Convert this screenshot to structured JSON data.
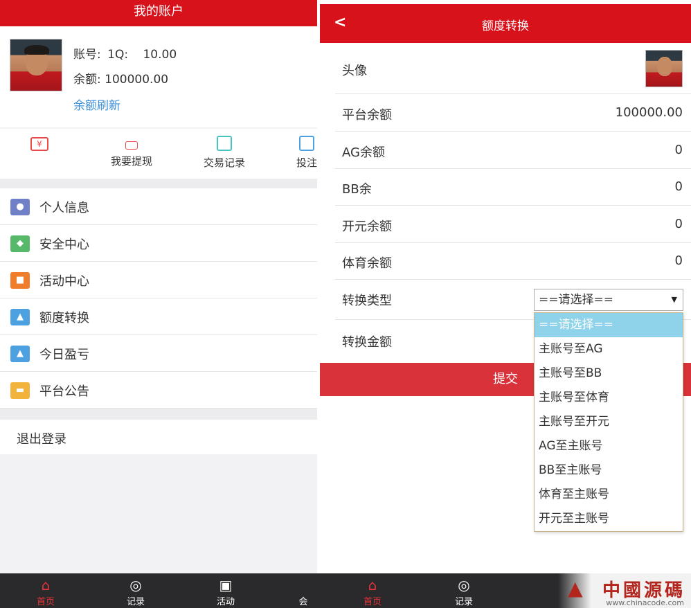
{
  "left_screen": {
    "title": "我的账户",
    "account_label": "账号:",
    "account_value": "1Q:",
    "account_extra": "10.00",
    "balance_label": "余额:",
    "balance_value": "100000.00",
    "refresh_link": "余额刷新",
    "quick_actions": [
      {
        "label": "我要提现",
        "icon": "withdraw-icon"
      },
      {
        "label": "交易记录",
        "icon": "transaction-icon"
      },
      {
        "label": "投注",
        "icon": "bet-icon"
      }
    ],
    "menu": [
      {
        "label": "个人信息",
        "icon": "user-icon",
        "color": "#6f7fc8"
      },
      {
        "label": "安全中心",
        "icon": "shield-icon",
        "color": "#56b96a"
      },
      {
        "label": "活动中心",
        "icon": "activity-icon",
        "color": "#ef7d2c"
      },
      {
        "label": "额度转换",
        "icon": "transfer-icon",
        "color": "#4da1e0"
      },
      {
        "label": "今日盈亏",
        "icon": "chart-icon",
        "color": "#4da1e0"
      },
      {
        "label": "平台公告",
        "icon": "notice-icon",
        "color": "#f2b33d"
      }
    ],
    "logout": "退出登录"
  },
  "right_screen": {
    "title": "额度转换",
    "rows": {
      "avatar": "头像",
      "platform_balance_label": "平台余额",
      "platform_balance_value": "100000.00",
      "ag_label": "AG余额",
      "ag_value": "0",
      "bb_label": "BB余",
      "bb_value": "0",
      "kaiyuan_label": "开元余额",
      "kaiyuan_value": "0",
      "sports_label": "体育余额",
      "sports_value": "0",
      "transfer_type_label": "转换类型",
      "transfer_amount_label": "转换金额"
    },
    "select_value": "==请选择==",
    "dropdown_options": [
      "==请选择==",
      "主账号至AG",
      "主账号至BB",
      "主账号至体育",
      "主账号至开元",
      "AG至主账号",
      "BB至主账号",
      "体育至主账号",
      "开元至主账号"
    ],
    "submit": "提交"
  },
  "tabbar": {
    "home": "首页",
    "records": "记录",
    "activity": "活动",
    "member": "会"
  },
  "watermark": {
    "text": "中國源碼",
    "url": "www.chinacode.com"
  },
  "colors": {
    "brand_red": "#d8121b",
    "link_blue": "#3b8fd8",
    "tab_bg": "#2a2a2c",
    "dropdown_selected": "#8fd3eb"
  }
}
